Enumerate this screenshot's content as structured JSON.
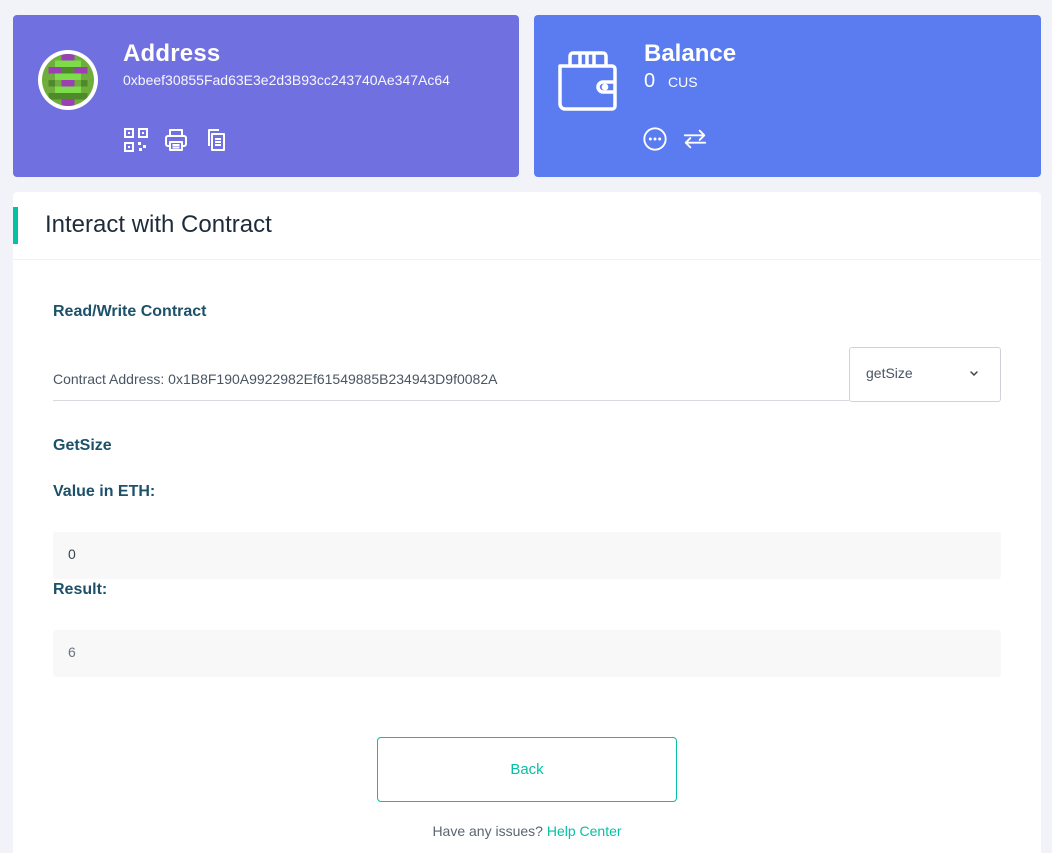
{
  "address_card": {
    "title": "Address",
    "address": "0xbeef30855Fad63E3e2d3B93cc243740Ae347Ac64",
    "icons": [
      "qr-code-icon",
      "print-icon",
      "copy-icon"
    ]
  },
  "balance_card": {
    "title": "Balance",
    "value": "0",
    "unit": "CUS",
    "icons": [
      "more-icon",
      "swap-icon"
    ]
  },
  "panel": {
    "title": "Interact with Contract",
    "read_write_label": "Read/Write Contract",
    "contract_address": "Contract Address: 0x1B8F190A9922982Ef61549885B234943D9f0082A",
    "selected_function": "getSize",
    "function_label": "GetSize",
    "value_label": "Value in ETH:",
    "value": "0",
    "result_label": "Result:",
    "result": "6",
    "back_label": "Back",
    "help_text": "Have any issues?",
    "help_link": "Help Center"
  },
  "colors": {
    "address_card": "#7070e1",
    "balance_card": "#5a7cf0",
    "accent": "#05c0a5",
    "label": "#1c5169"
  }
}
